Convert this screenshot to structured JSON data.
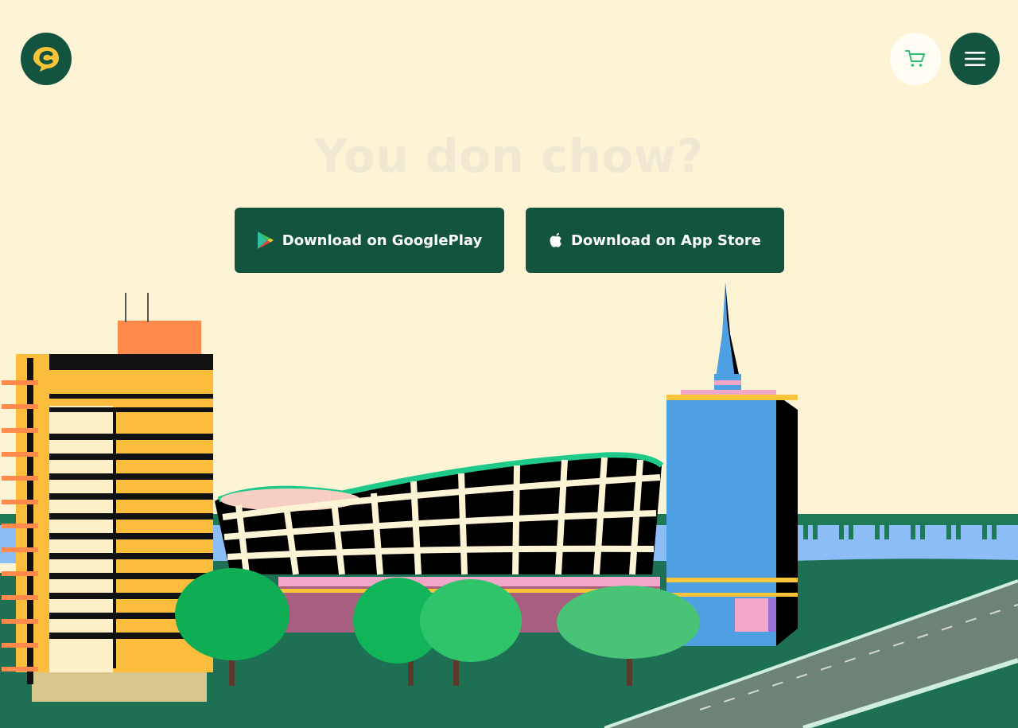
{
  "header": {
    "logo_icon": "brand-logo-icon",
    "cart_icon": "cart-icon",
    "menu_icon": "hamburger-menu-icon"
  },
  "hero": {
    "headline": "You don chow?",
    "buttons": [
      {
        "label": "Download on GooglePlay",
        "icon": "google-play-icon"
      },
      {
        "label": "Download on App Store",
        "icon": "apple-icon"
      }
    ]
  },
  "colors": {
    "background": "#fdf4d6",
    "brand_green": "#12543f",
    "button_text": "#ffffff",
    "cart_accent": "#2fbf71"
  }
}
